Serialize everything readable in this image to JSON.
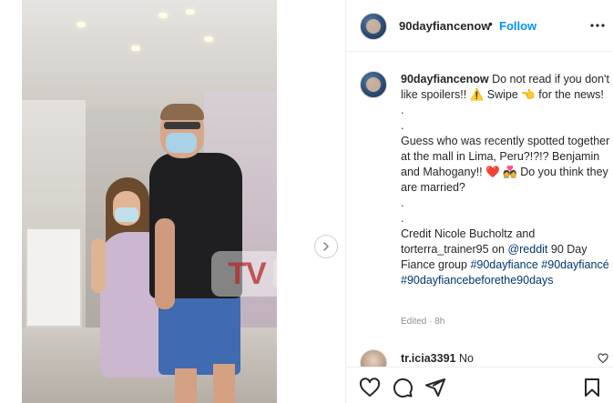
{
  "header": {
    "username": "90dayfiancenow",
    "separator": "•",
    "follow_label": "Follow",
    "more_icon": "more-options-icon"
  },
  "caption": {
    "username": "90dayfiancenow",
    "line1": "Do not read if you don't like spoilers!! ⚠️ Swipe 👈 for the news!",
    "dot1": ".",
    "dot2": ".",
    "line2": "Guess who was recently spotted together at the mall in Lima, Peru?!?!? Benjamin and Mahogany!! ❤️ 💑 Do you think they are married?",
    "dot3": ".",
    "dot4": ".",
    "credit": "Credit Nicole Bucholtz and torterra_trainer95 on",
    "credit_mention": "@reddit",
    "credit_after": "90 Day Fiance group",
    "hashtags": "#90dayfiance #90dayfiancé #90dayfiancebeforethe90days",
    "edited": "Edited · 8h"
  },
  "comment": {
    "username": "tr.icia3391",
    "text": "No"
  },
  "media": {
    "watermark": "TV",
    "next_icon": "chevron-right-icon"
  },
  "actions": {
    "like_icon": "heart-icon",
    "comment_icon": "comment-icon",
    "share_icon": "share-icon",
    "save_icon": "bookmark-icon"
  }
}
